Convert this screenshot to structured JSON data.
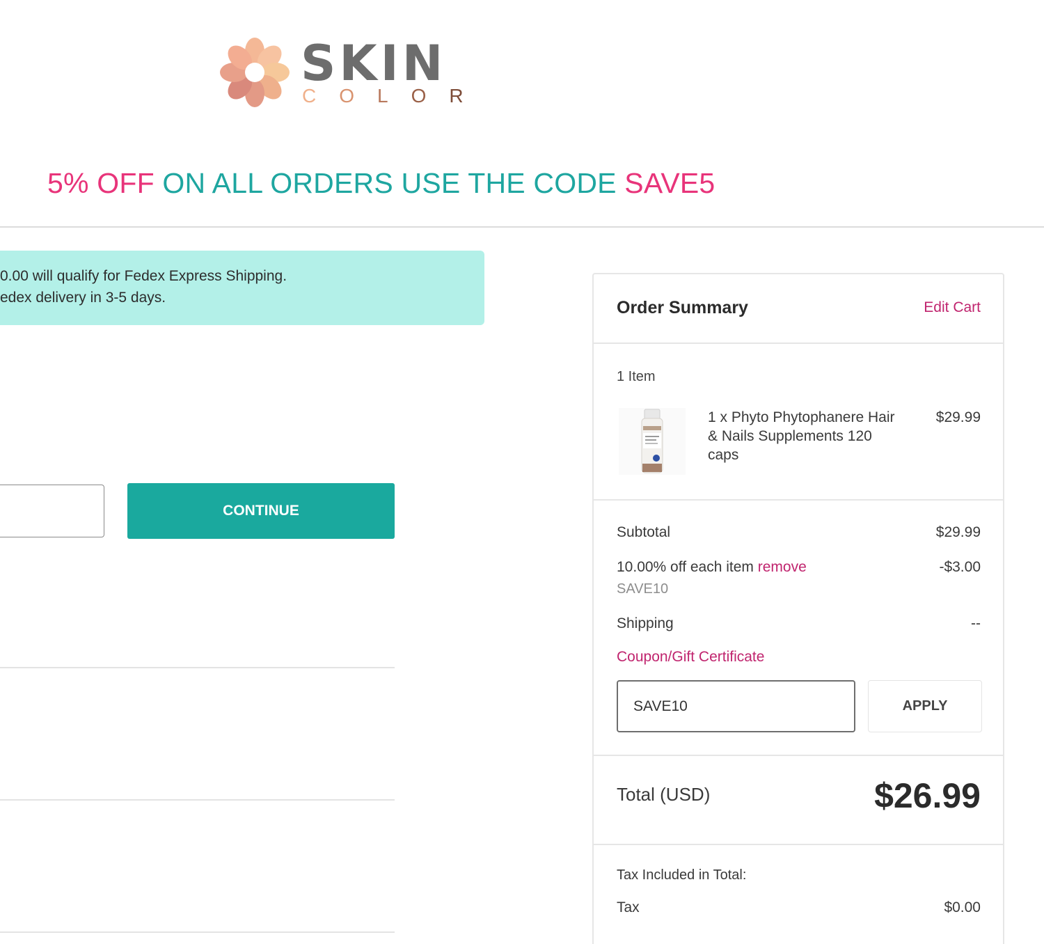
{
  "brand": {
    "name_main": "SKIN",
    "name_sub": [
      "C",
      "O",
      "L",
      "O",
      "R"
    ]
  },
  "promo": {
    "part1": "5% OFF",
    "part2": " ON ALL ORDERS USE THE CODE ",
    "part3": "SAVE5",
    "colors": {
      "pink": "#e8347a",
      "teal": "#1ea6a0"
    }
  },
  "shipping_notice": {
    "line1": "0.00 will qualify for Fedex Express Shipping.",
    "line2": "edex delivery in 3-5 days."
  },
  "checkout": {
    "continue_label": "CONTINUE"
  },
  "order_summary": {
    "title": "Order Summary",
    "edit_cart": "Edit Cart",
    "item_count": "1 Item",
    "items": [
      {
        "name": "1 x Phyto Phytophanere Hair & Nails Supplements 120 caps",
        "price": "$29.99",
        "thumbnail_icon": "supplement-bottle-icon"
      }
    ],
    "subtotal_label": "Subtotal",
    "subtotal_value": "$29.99",
    "discount_label": "10.00% off each item",
    "discount_remove": "remove",
    "discount_value": "-$3.00",
    "discount_code": "SAVE10",
    "shipping_label": "Shipping",
    "shipping_value": "--",
    "coupon_link": "Coupon/Gift Certificate",
    "coupon_input_value": "SAVE10",
    "apply_label": "APPLY",
    "total_label": "Total (USD)",
    "total_value": "$26.99",
    "tax_included_label": "Tax Included in Total:",
    "tax_label": "Tax",
    "tax_value": "$0.00"
  },
  "colors": {
    "accent_teal": "#1aa99e",
    "notice_bg": "#b3f0e8",
    "link_magenta": "#c0246e"
  }
}
